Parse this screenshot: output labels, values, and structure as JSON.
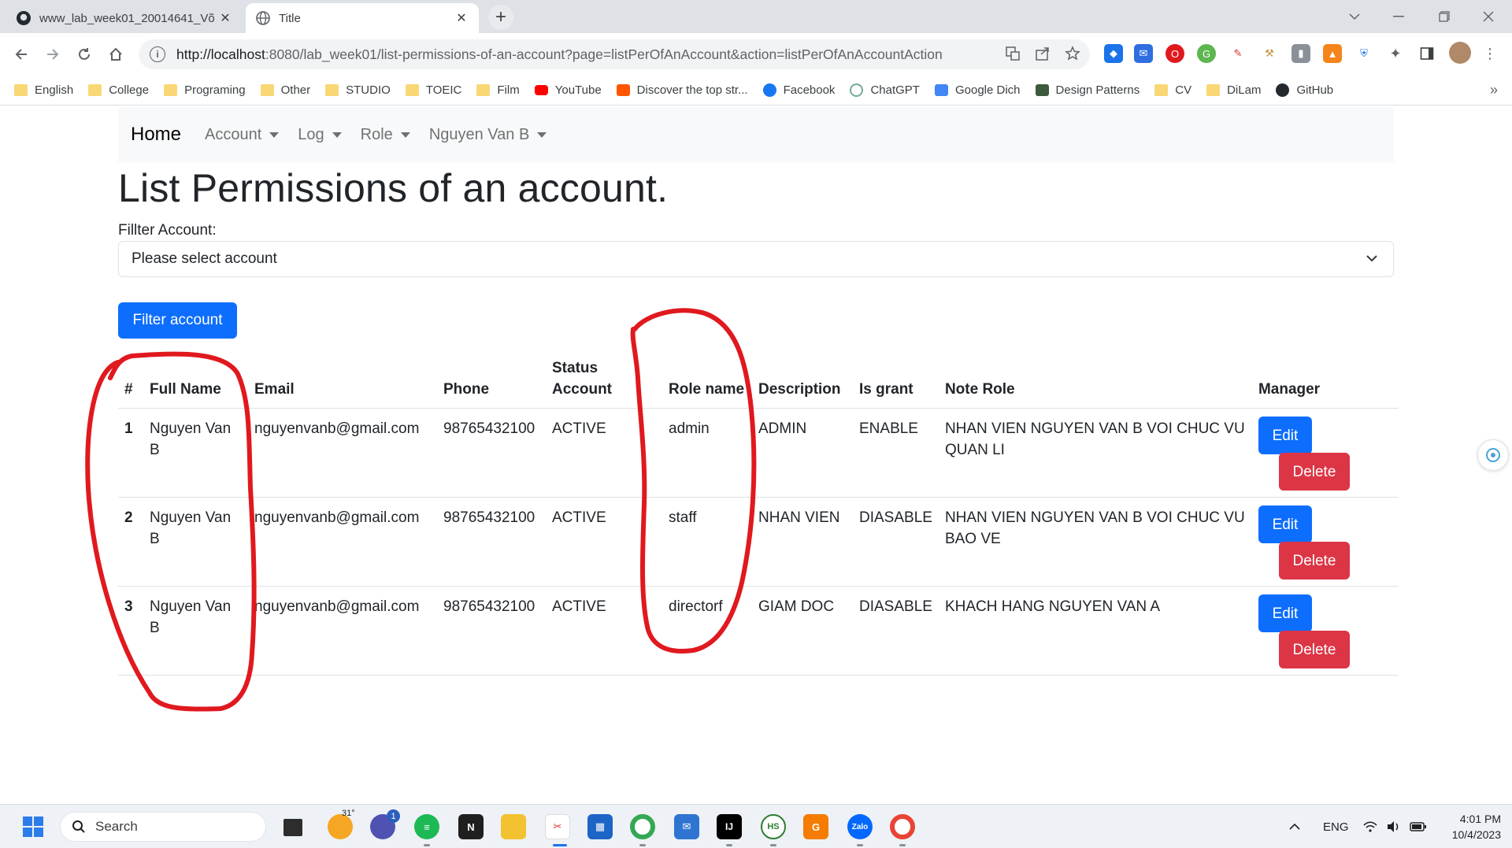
{
  "browser": {
    "tabs": [
      {
        "title": "www_lab_week01_20014641_Võ",
        "close": "✕"
      },
      {
        "title": "Title",
        "close": "✕"
      }
    ],
    "new_tab": "+",
    "url_host": "http://localhost",
    "url_rest": ":8080/lab_week01/list-permissions-of-an-account?page=listPerOfAnAccount&action=listPerOfAnAccountAction",
    "bookmarks": [
      {
        "label": "English",
        "icon": "folder-icon"
      },
      {
        "label": "College",
        "icon": "folder-icon"
      },
      {
        "label": "Programing",
        "icon": "folder-icon"
      },
      {
        "label": "Other",
        "icon": "folder-icon"
      },
      {
        "label": "STUDIO",
        "icon": "folder-icon"
      },
      {
        "label": "TOEIC",
        "icon": "folder-icon"
      },
      {
        "label": "Film",
        "icon": "folder-icon"
      },
      {
        "label": "YouTube",
        "icon": "youtube-icon"
      },
      {
        "label": "Discover the top str...",
        "icon": "soundcloud-icon"
      },
      {
        "label": "Facebook",
        "icon": "facebook-icon"
      },
      {
        "label": "ChatGPT",
        "icon": "chatgpt-icon"
      },
      {
        "label": "Google Dich",
        "icon": "translate-icon"
      },
      {
        "label": "Design Patterns",
        "icon": "design-patterns-icon"
      },
      {
        "label": "CV",
        "icon": "folder-icon"
      },
      {
        "label": "DiLam",
        "icon": "folder-icon"
      },
      {
        "label": "GitHub",
        "icon": "github-icon"
      }
    ],
    "bookmarks_more": "»"
  },
  "navbar": {
    "brand": "Home",
    "items": [
      "Account",
      "Log",
      "Role",
      "Nguyen Van B"
    ]
  },
  "page": {
    "title": "List Permissions of an account.",
    "filter_label": "Fillter Account:",
    "select_value": "Please select account",
    "filter_button": "Filter account"
  },
  "table": {
    "headers": [
      "#",
      "Full Name",
      "Email",
      "Phone",
      "Status Account",
      "Role name",
      "Description",
      "Is grant",
      "Note Role",
      "Manager"
    ],
    "rows": [
      {
        "idx": "1",
        "full_name": "Nguyen Van B",
        "email": "nguyenvanb@gmail.com",
        "phone": "98765432100",
        "status": "ACTIVE",
        "role": "admin",
        "description": "ADMIN",
        "grant": "ENABLE",
        "note": "NHAN VIEN NGUYEN VAN B VOI CHUC VU QUAN LI",
        "edit": "Edit",
        "delete": "Delete"
      },
      {
        "idx": "2",
        "full_name": "Nguyen Van B",
        "email": "nguyenvanb@gmail.com",
        "phone": "98765432100",
        "status": "ACTIVE",
        "role": "staff",
        "description": "NHAN VIEN",
        "grant": "DIASABLE",
        "note": "NHAN VIEN NGUYEN VAN B VOI CHUC VU BAO VE",
        "edit": "Edit",
        "delete": "Delete"
      },
      {
        "idx": "3",
        "full_name": "Nguyen Van B",
        "email": "nguyenvanb@gmail.com",
        "phone": "98765432100",
        "status": "ACTIVE",
        "role": "directorf",
        "description": "GIAM DOC",
        "grant": "DIASABLE",
        "note": "KHACH HANG NGUYEN VAN A",
        "edit": "Edit",
        "delete": "Delete"
      }
    ]
  },
  "annotation_color": "#e0191f",
  "taskbar": {
    "search_placeholder": "Search",
    "weather_temp": "31°",
    "chat_badge": "1",
    "lang": "ENG",
    "time": "4:01 PM",
    "date": "10/4/2023"
  }
}
